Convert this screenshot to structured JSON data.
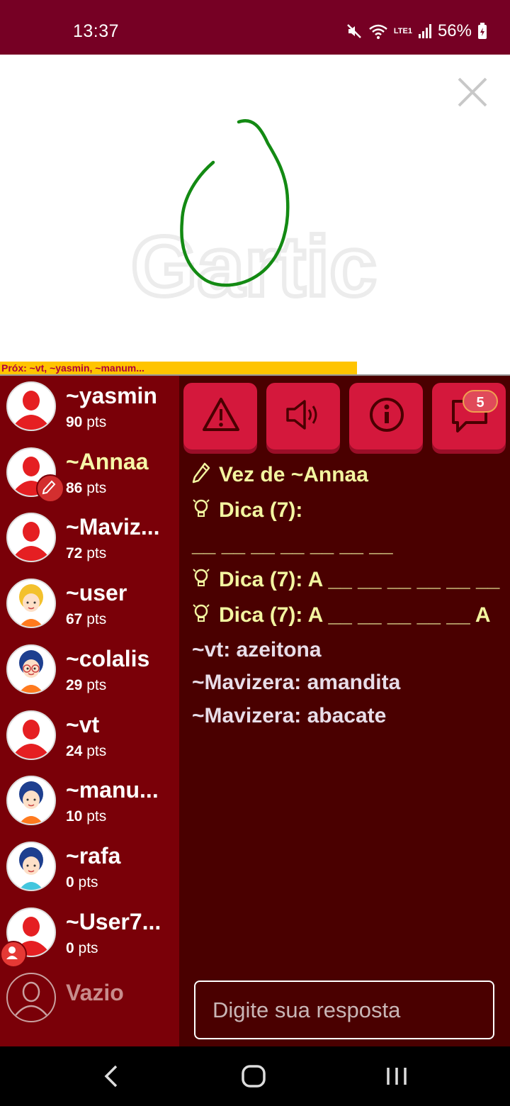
{
  "status": {
    "time": "13:37",
    "battery": "56%",
    "network": "LTE1"
  },
  "canvas": {
    "watermark": "Gartic"
  },
  "next_bar": {
    "text": "Próx: ~vt, ~yasmin, ~manum...",
    "progress_fraction": 0.7
  },
  "players": [
    {
      "name": "~yasmin",
      "points": "90",
      "avatar": "default"
    },
    {
      "name": "~Annaa",
      "points": "86",
      "avatar": "default",
      "drawing": true
    },
    {
      "name": "~Maviz...",
      "points": "72",
      "avatar": "default"
    },
    {
      "name": "~user",
      "points": "67",
      "avatar": "boy-cap"
    },
    {
      "name": "~colalis",
      "points": "29",
      "avatar": "girl-glasses"
    },
    {
      "name": "~vt",
      "points": "24",
      "avatar": "default"
    },
    {
      "name": "~manu...",
      "points": "10",
      "avatar": "girl-blue-hair"
    },
    {
      "name": "~rafa",
      "points": "0",
      "avatar": "girl-curly"
    },
    {
      "name": "~User7...",
      "points": "0",
      "avatar": "default",
      "owner": true
    }
  ],
  "pts_unit": "pts",
  "empty_slot": "Vazio",
  "toolbar": {
    "chat_badge": "5"
  },
  "chat": {
    "turn": "Vez de ~Annaa",
    "hint1_label": "Dica (7):",
    "hint1_pattern": "__ __ __ __ __ __ __",
    "hint2": "Dica (7): A __ __ __ __ __ __",
    "hint3": "Dica (7): A __ __ __ __ __ A",
    "messages": [
      "~vt: azeitona",
      "~Mavizera: amandita",
      "~Mavizera: abacate"
    ]
  },
  "input": {
    "placeholder": "Digite sua resposta"
  },
  "colors": {
    "header": "#760024",
    "sidebar": "#7a0008",
    "chat_bg": "#4a0000",
    "button": "#d4183c",
    "turn_text": "#f3f5a0",
    "stroke": "#138a13"
  }
}
